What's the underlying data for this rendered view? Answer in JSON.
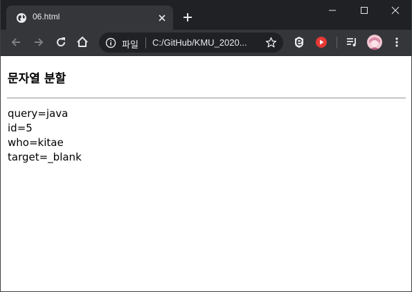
{
  "tab": {
    "title": "06.html"
  },
  "omnibox": {
    "scheme_label": "파일",
    "url": "C:/GitHub/KMU_2020..."
  },
  "page": {
    "heading": "문자열 분할",
    "lines": [
      "query=java",
      "id=5",
      "who=kitae",
      "target=_blank"
    ]
  },
  "colors": {
    "tabstrip_bg": "#202124",
    "toolbar_bg": "#35363a",
    "extension_red": "#e53935"
  },
  "icons": {
    "tab": [
      "globe-icon",
      "close-icon",
      "plus-icon"
    ],
    "window": [
      "minimize-icon",
      "maximize-icon",
      "close-icon"
    ],
    "toolbar": [
      "back-arrow-icon",
      "forward-arrow-icon",
      "reload-icon",
      "home-icon",
      "info-icon",
      "star-icon",
      "extension-icon",
      "youtube-icon",
      "media-queue-icon",
      "avatar",
      "more-vertical-icon"
    ]
  }
}
